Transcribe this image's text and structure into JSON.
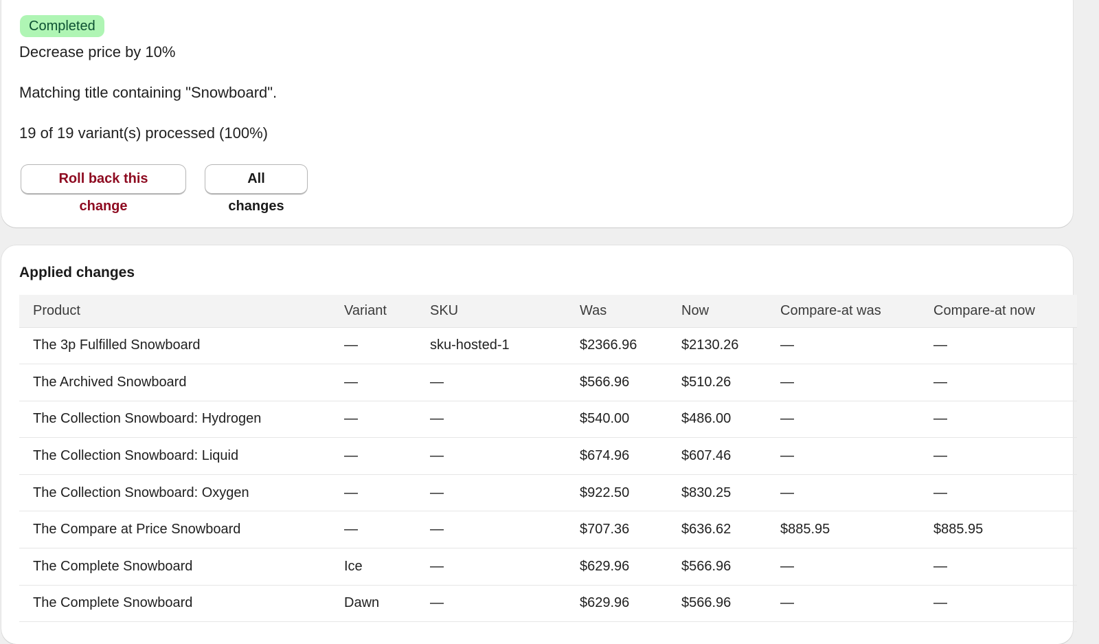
{
  "colors": {
    "badge_bg": "#aff5b4",
    "badge_text": "#0c5132",
    "rollback_text": "#8e0b21"
  },
  "summary": {
    "status": "Completed",
    "action": "Decrease price by 10%",
    "filter": "Matching title containing \"Snowboard\".",
    "progress": "19 of 19 variant(s) processed (100%)",
    "rollback_label": "Roll back this change",
    "all_changes_label": "All changes"
  },
  "applied": {
    "title": "Applied changes",
    "columns": [
      "Product",
      "Variant",
      "SKU",
      "Was",
      "Now",
      "Compare-at was",
      "Compare-at now"
    ],
    "rows": [
      [
        "The 3p Fulfilled Snowboard",
        "—",
        "sku-hosted-1",
        "$2366.96",
        "$2130.26",
        "—",
        "—"
      ],
      [
        "The Archived Snowboard",
        "—",
        "—",
        "$566.96",
        "$510.26",
        "—",
        "—"
      ],
      [
        "The Collection Snowboard: Hydrogen",
        "—",
        "—",
        "$540.00",
        "$486.00",
        "—",
        "—"
      ],
      [
        "The Collection Snowboard: Liquid",
        "—",
        "—",
        "$674.96",
        "$607.46",
        "—",
        "—"
      ],
      [
        "The Collection Snowboard: Oxygen",
        "—",
        "—",
        "$922.50",
        "$830.25",
        "—",
        "—"
      ],
      [
        "The Compare at Price Snowboard",
        "—",
        "—",
        "$707.36",
        "$636.62",
        "$885.95",
        "$885.95"
      ],
      [
        "The Complete Snowboard",
        "Ice",
        "—",
        "$629.96",
        "$566.96",
        "—",
        "—"
      ],
      [
        "The Complete Snowboard",
        "Dawn",
        "—",
        "$629.96",
        "$566.96",
        "—",
        "—"
      ]
    ]
  }
}
